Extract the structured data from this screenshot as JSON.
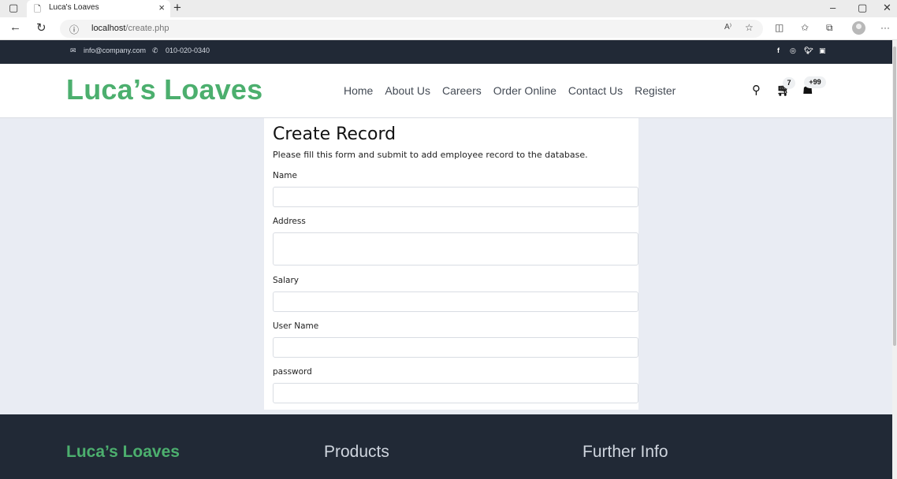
{
  "browser": {
    "tab_title": "Luca's Loaves",
    "url_host": "localhost",
    "url_path": "/create.php"
  },
  "topbar": {
    "email": "info@company.com",
    "phone": "010-020-0340",
    "social": [
      "facebook-icon",
      "instagram-icon",
      "twitter-icon",
      "linkedin-icon"
    ]
  },
  "header": {
    "logo": "Luca’s Loaves",
    "nav": [
      "Home",
      "About Us",
      "Careers",
      "Order Online",
      "Contact Us",
      "Register"
    ],
    "cart_count": "7",
    "user_count": "+99"
  },
  "form": {
    "title": "Create Record",
    "subtitle": "Please fill this form and submit to add employee record to the database.",
    "fields": [
      {
        "label": "Name",
        "value": ""
      },
      {
        "label": "Address",
        "value": ""
      },
      {
        "label": "Salary",
        "value": ""
      },
      {
        "label": "User Name",
        "value": ""
      },
      {
        "label": "password",
        "value": ""
      }
    ]
  },
  "footer": {
    "brand": "Luca’s Loaves",
    "col2": "Products",
    "col3": "Further Info"
  },
  "colors": {
    "brand_green": "#4caf6e",
    "dark_bar": "#212936",
    "page_bg": "#e9ecf3"
  }
}
